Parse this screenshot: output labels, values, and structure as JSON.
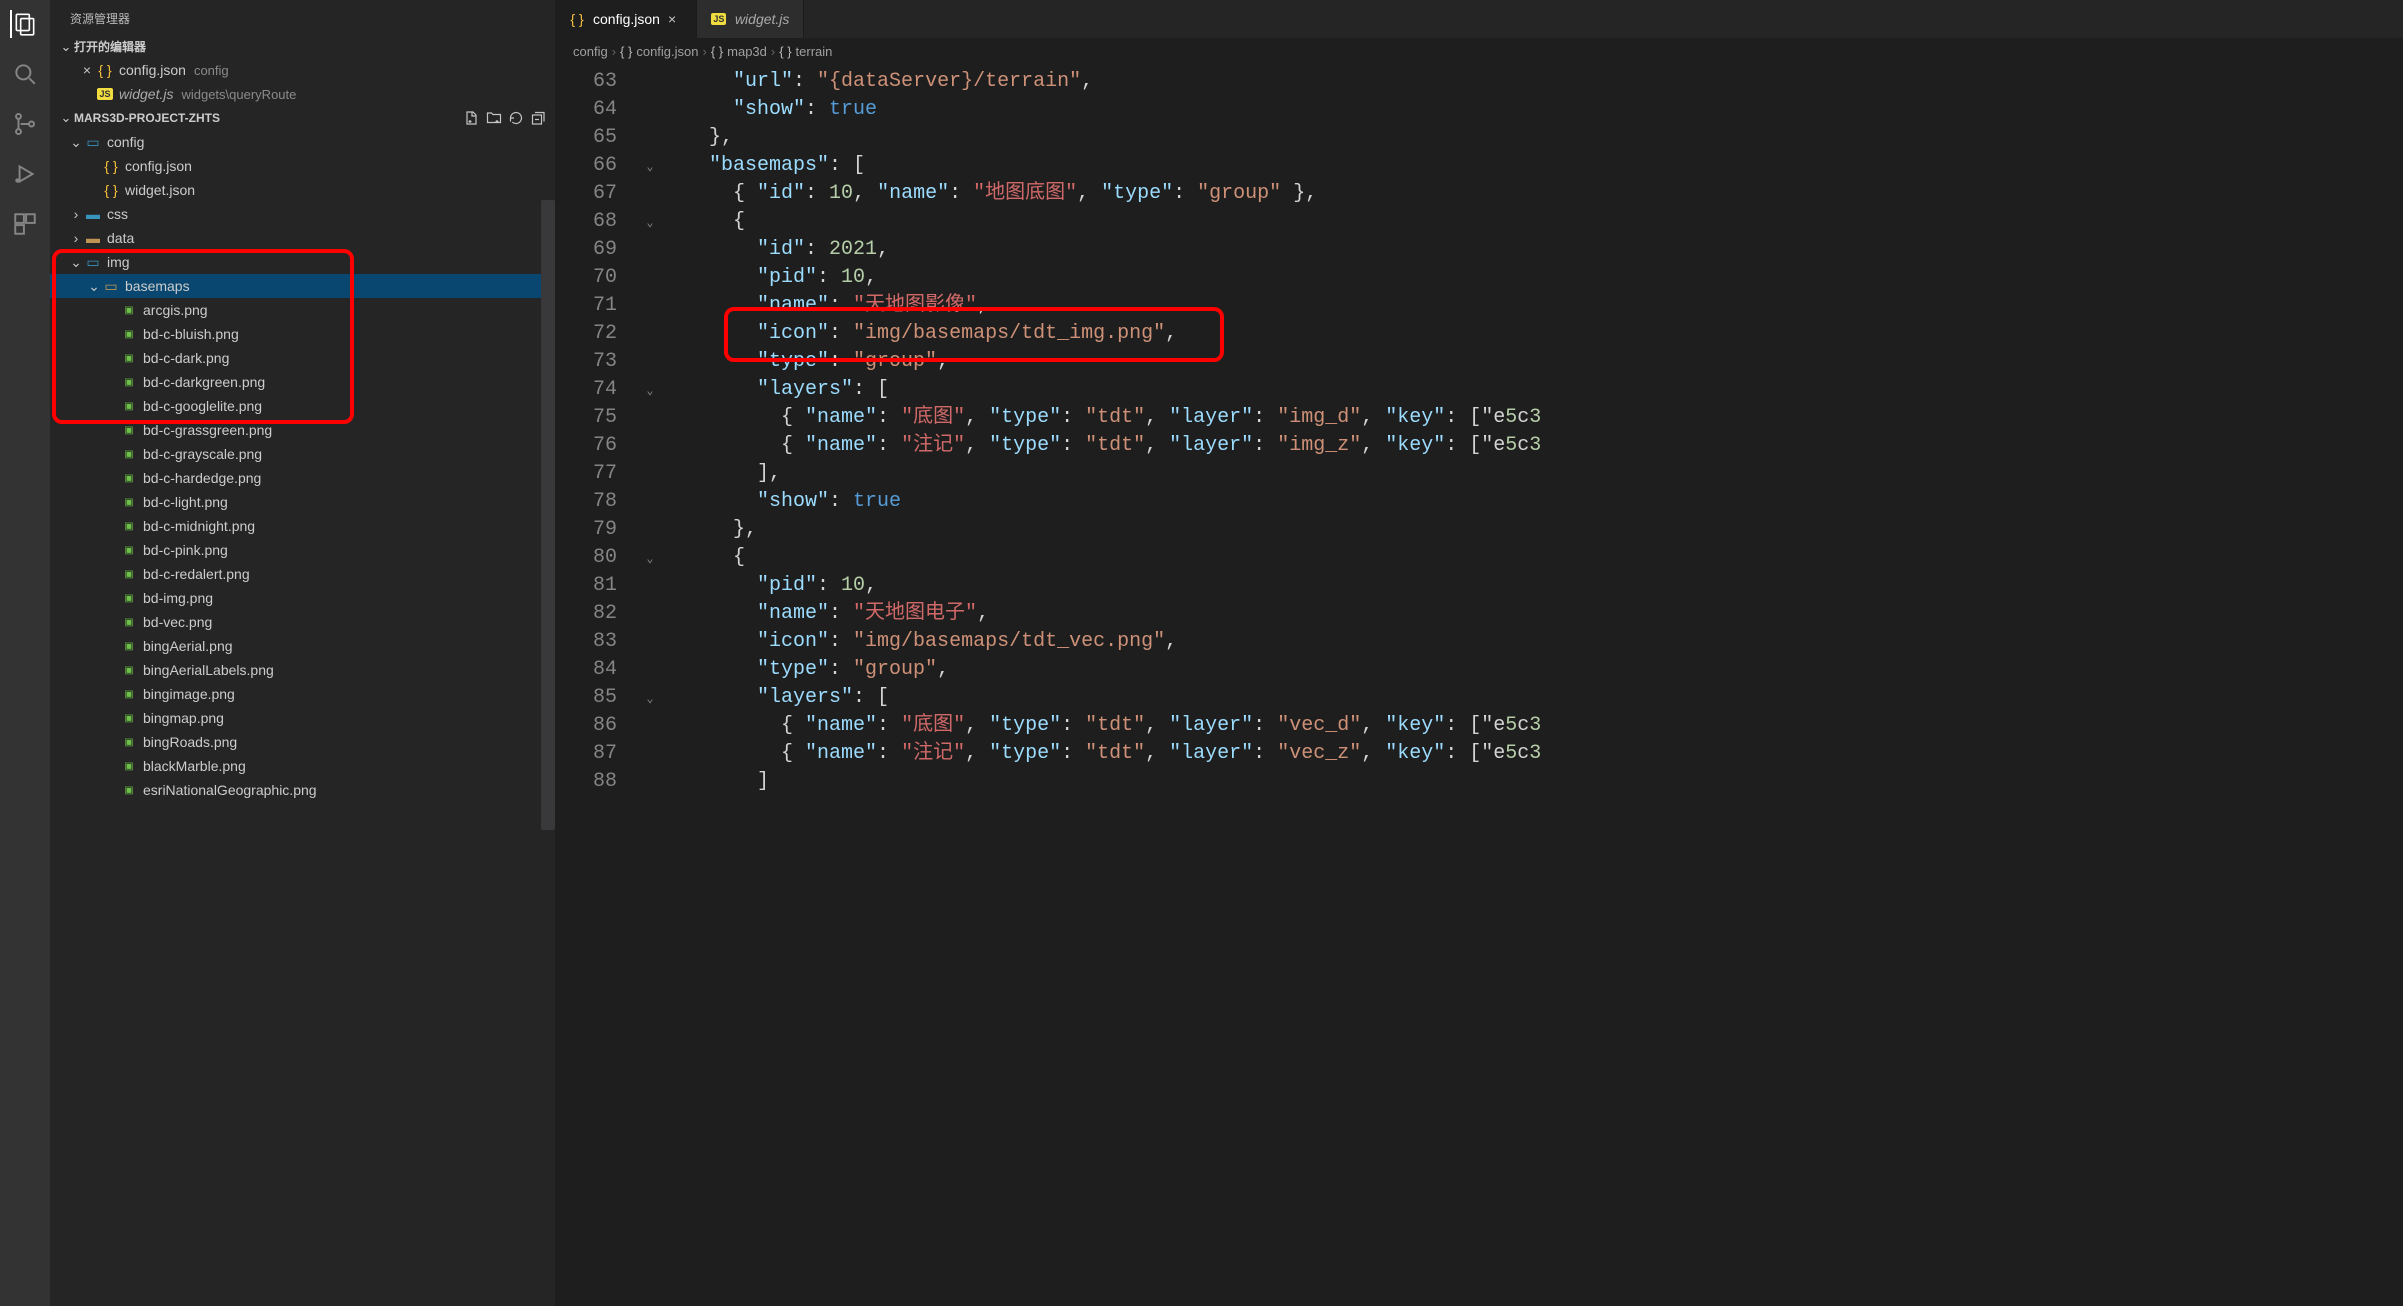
{
  "sidebarTitle": "资源管理器",
  "openEditorsTitle": "打开的编辑器",
  "openEditors": [
    {
      "name": "config.json",
      "desc": "config",
      "icon": "json",
      "active": true
    },
    {
      "name": "widget.js",
      "desc": "widgets\\queryRoute",
      "icon": "js",
      "italic": true
    }
  ],
  "projectName": "MARS3D-PROJECT-ZHTS",
  "tree": [
    {
      "depth": 0,
      "kind": "folder",
      "open": true,
      "label": "config",
      "icon": "folder-open-blue"
    },
    {
      "depth": 1,
      "kind": "file",
      "label": "config.json",
      "icon": "json"
    },
    {
      "depth": 1,
      "kind": "file",
      "label": "widget.json",
      "icon": "json"
    },
    {
      "depth": 0,
      "kind": "folder",
      "open": false,
      "label": "css",
      "icon": "folder-blue"
    },
    {
      "depth": 0,
      "kind": "folder",
      "open": false,
      "label": "data",
      "icon": "folder"
    },
    {
      "depth": 0,
      "kind": "folder",
      "open": true,
      "label": "img",
      "icon": "folder-open-blue"
    },
    {
      "depth": 1,
      "kind": "folder",
      "open": true,
      "label": "basemaps",
      "icon": "folder-open",
      "selected": true
    },
    {
      "depth": 2,
      "kind": "file",
      "label": "arcgis.png",
      "icon": "img"
    },
    {
      "depth": 2,
      "kind": "file",
      "label": "bd-c-bluish.png",
      "icon": "img"
    },
    {
      "depth": 2,
      "kind": "file",
      "label": "bd-c-dark.png",
      "icon": "img"
    },
    {
      "depth": 2,
      "kind": "file",
      "label": "bd-c-darkgreen.png",
      "icon": "img"
    },
    {
      "depth": 2,
      "kind": "file",
      "label": "bd-c-googlelite.png",
      "icon": "img"
    },
    {
      "depth": 2,
      "kind": "file",
      "label": "bd-c-grassgreen.png",
      "icon": "img"
    },
    {
      "depth": 2,
      "kind": "file",
      "label": "bd-c-grayscale.png",
      "icon": "img"
    },
    {
      "depth": 2,
      "kind": "file",
      "label": "bd-c-hardedge.png",
      "icon": "img"
    },
    {
      "depth": 2,
      "kind": "file",
      "label": "bd-c-light.png",
      "icon": "img"
    },
    {
      "depth": 2,
      "kind": "file",
      "label": "bd-c-midnight.png",
      "icon": "img"
    },
    {
      "depth": 2,
      "kind": "file",
      "label": "bd-c-pink.png",
      "icon": "img"
    },
    {
      "depth": 2,
      "kind": "file",
      "label": "bd-c-redalert.png",
      "icon": "img"
    },
    {
      "depth": 2,
      "kind": "file",
      "label": "bd-img.png",
      "icon": "img"
    },
    {
      "depth": 2,
      "kind": "file",
      "label": "bd-vec.png",
      "icon": "img"
    },
    {
      "depth": 2,
      "kind": "file",
      "label": "bingAerial.png",
      "icon": "img"
    },
    {
      "depth": 2,
      "kind": "file",
      "label": "bingAerialLabels.png",
      "icon": "img"
    },
    {
      "depth": 2,
      "kind": "file",
      "label": "bingimage.png",
      "icon": "img"
    },
    {
      "depth": 2,
      "kind": "file",
      "label": "bingmap.png",
      "icon": "img"
    },
    {
      "depth": 2,
      "kind": "file",
      "label": "bingRoads.png",
      "icon": "img"
    },
    {
      "depth": 2,
      "kind": "file",
      "label": "blackMarble.png",
      "icon": "img"
    },
    {
      "depth": 2,
      "kind": "file",
      "label": "esriNationalGeographic.png",
      "icon": "img"
    }
  ],
  "tabs": [
    {
      "label": "config.json",
      "icon": "json",
      "active": true
    },
    {
      "label": "widget.js",
      "icon": "js",
      "active": false,
      "italic": true
    }
  ],
  "breadcrumb": [
    "config",
    "config.json",
    "map3d",
    "terrain"
  ],
  "code": {
    "startLine": 63,
    "lines": [
      "      \"url\": \"{dataServer}/terrain\",",
      "      \"show\": true",
      "    },",
      "    \"basemaps\": [",
      "      { \"id\": 10, \"name\": \"地图底图\", \"type\": \"group\" },",
      "      {",
      "        \"id\": 2021,",
      "        \"pid\": 10,",
      "        \"name\": \"天地图影像\",",
      "        \"icon\": \"img/basemaps/tdt_img.png\",",
      "        \"type\": \"group\",",
      "        \"layers\": [",
      "          { \"name\": \"底图\", \"type\": \"tdt\", \"layer\": \"img_d\", \"key\": [\"e5c3",
      "          { \"name\": \"注记\", \"type\": \"tdt\", \"layer\": \"img_z\", \"key\": [\"e5c3",
      "        ],",
      "        \"show\": true",
      "      },",
      "      {",
      "        \"pid\": 10,",
      "        \"name\": \"天地图电子\",",
      "        \"icon\": \"img/basemaps/tdt_vec.png\",",
      "        \"type\": \"group\",",
      "        \"layers\": [",
      "          { \"name\": \"底图\", \"type\": \"tdt\", \"layer\": \"vec_d\", \"key\": [\"e5c3",
      "          { \"name\": \"注记\", \"type\": \"tdt\", \"layer\": \"vec_z\", \"key\": [\"e5c3",
      "        ]"
    ]
  }
}
